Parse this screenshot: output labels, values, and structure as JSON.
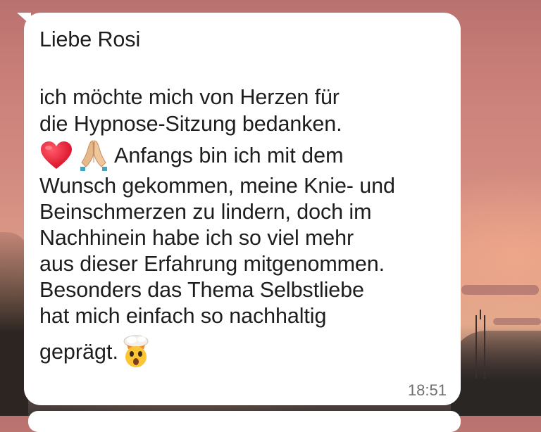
{
  "message": {
    "greeting": "Liebe Rosi",
    "lines": [
      "ich möchte mich von Herzen für",
      "die Hypnose-Sitzung bedanken."
    ],
    "emoji_line_text": "Anfangs bin ich mit dem",
    "body_lines": [
      "Wunsch gekommen, meine Knie- und",
      "Beinschmerzen zu lindern, doch im",
      "Nachhinein habe ich so viel mehr",
      "aus dieser Erfahrung mitgenommen.",
      "Besonders das Thema Selbstliebe",
      "hat mich einfach so nachhaltig"
    ],
    "last_line": "geprägt.",
    "time": "18:51",
    "emojis": [
      "red-heart-icon",
      "folded-hands-icon",
      "exploding-head-icon"
    ]
  },
  "colors": {
    "bubble": "#ffffff",
    "text": "#1d1d1d",
    "time": "#6f6f6f"
  }
}
